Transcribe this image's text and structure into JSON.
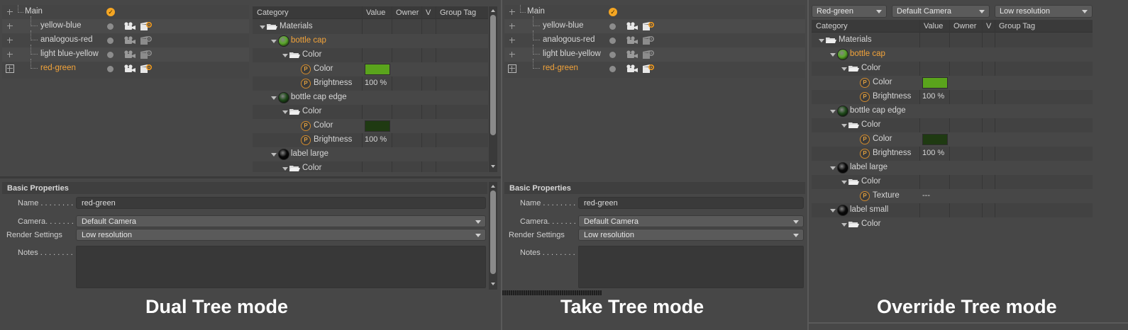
{
  "takes": {
    "root": "Main",
    "items": [
      "yellow-blue",
      "analogous-red",
      "light blue-yellow",
      "red-green"
    ],
    "active": "red-green"
  },
  "table": {
    "headers": [
      "Category",
      "Value",
      "Owner",
      "V",
      "Group Tag"
    ],
    "rows": [
      {
        "label": "Materials",
        "kind": "folder"
      },
      {
        "label": "bottle cap",
        "kind": "material",
        "color": "#5aa82a"
      },
      {
        "label": "Color",
        "kind": "folder"
      },
      {
        "label": "Color",
        "kind": "param",
        "swatch": "#5aa41c"
      },
      {
        "label": "Brightness",
        "kind": "param",
        "value": "100 %"
      },
      {
        "label": "bottle cap edge",
        "kind": "material",
        "color": "#1f4a1a"
      },
      {
        "label": "Color",
        "kind": "folder"
      },
      {
        "label": "Color",
        "kind": "param",
        "swatch": "#1f3a12"
      },
      {
        "label": "Brightness",
        "kind": "param",
        "value": "100 %"
      },
      {
        "label": "label large",
        "kind": "material",
        "color": "#0a0a0a"
      },
      {
        "label": "Color",
        "kind": "folder"
      },
      {
        "label": "Texture",
        "kind": "param",
        "value": "---"
      },
      {
        "label": "label small",
        "kind": "material",
        "color": "#0a0a0a"
      },
      {
        "label": "Color",
        "kind": "folder"
      }
    ]
  },
  "override_toolbar": {
    "take": "Red-green",
    "camera": "Default Camera",
    "render": "Low resolution"
  },
  "properties": {
    "header": "Basic Properties",
    "name_label": "Name . . . . . . . .",
    "name_value": "red-green",
    "camera_label": "Camera. . . . . . .",
    "camera_value": "Default Camera",
    "render_label": "Render Settings",
    "render_value": "Low resolution",
    "notes_label": "Notes . . . . . . . ."
  },
  "captions": {
    "dual": "Dual Tree mode",
    "take": "Take Tree mode",
    "override": "Override Tree mode"
  },
  "colors": {
    "active_text": "#f2a33a",
    "bottle_cap_swatch": "#5aa41c",
    "edge_swatch": "#1f3a12"
  }
}
